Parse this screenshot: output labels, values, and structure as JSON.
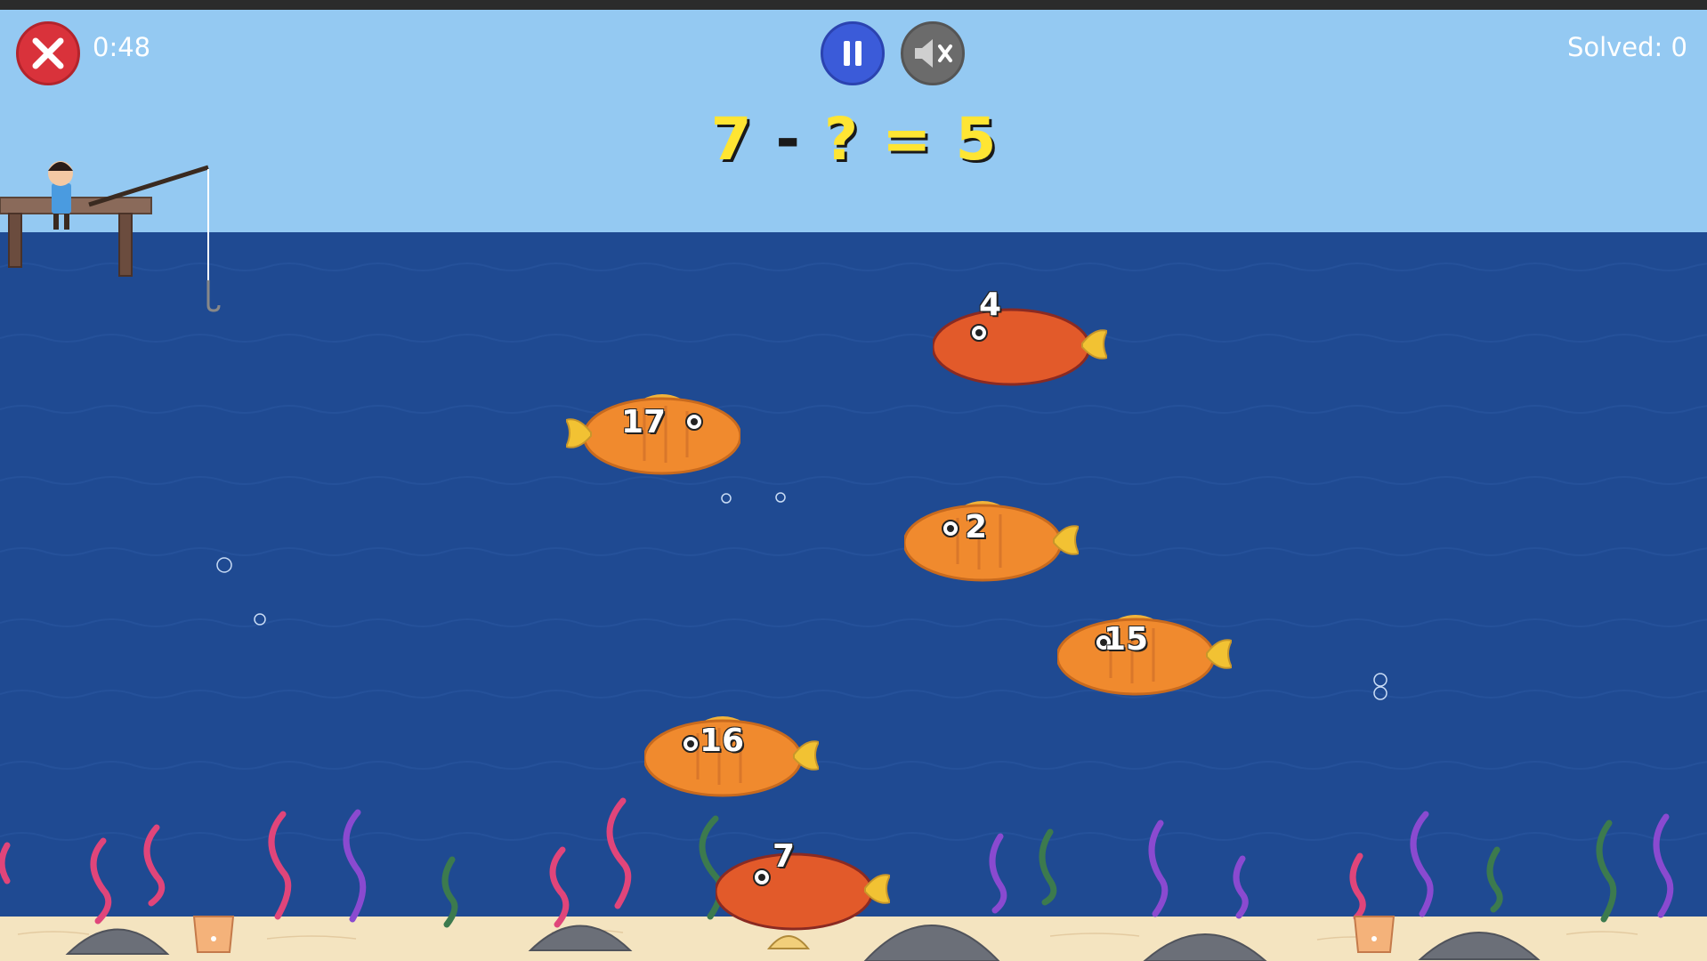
{
  "hud": {
    "timer": "0:48",
    "solved_label": "Solved: 0"
  },
  "equation": {
    "a": "7",
    "op": "-",
    "unknown": "?",
    "eq": "=",
    "result": "5"
  },
  "fish": [
    {
      "number": "4",
      "color": "#e25a2a",
      "style": "red"
    },
    {
      "number": "17",
      "color": "#f08a2e",
      "style": "orange"
    },
    {
      "number": "2",
      "color": "#f08a2e",
      "style": "orange"
    },
    {
      "number": "15",
      "color": "#f08a2e",
      "style": "orange"
    },
    {
      "number": "16",
      "color": "#f08a2e",
      "style": "orange"
    },
    {
      "number": "7",
      "color": "#e25a2a",
      "style": "red"
    }
  ],
  "icons": {
    "close": "close-icon",
    "pause": "pause-icon",
    "mute": "mute-icon"
  },
  "colors": {
    "sky": "#94c9f2",
    "sea": "#1f4a92",
    "sand": "#f4e4c0",
    "equation": "#ffe533"
  }
}
